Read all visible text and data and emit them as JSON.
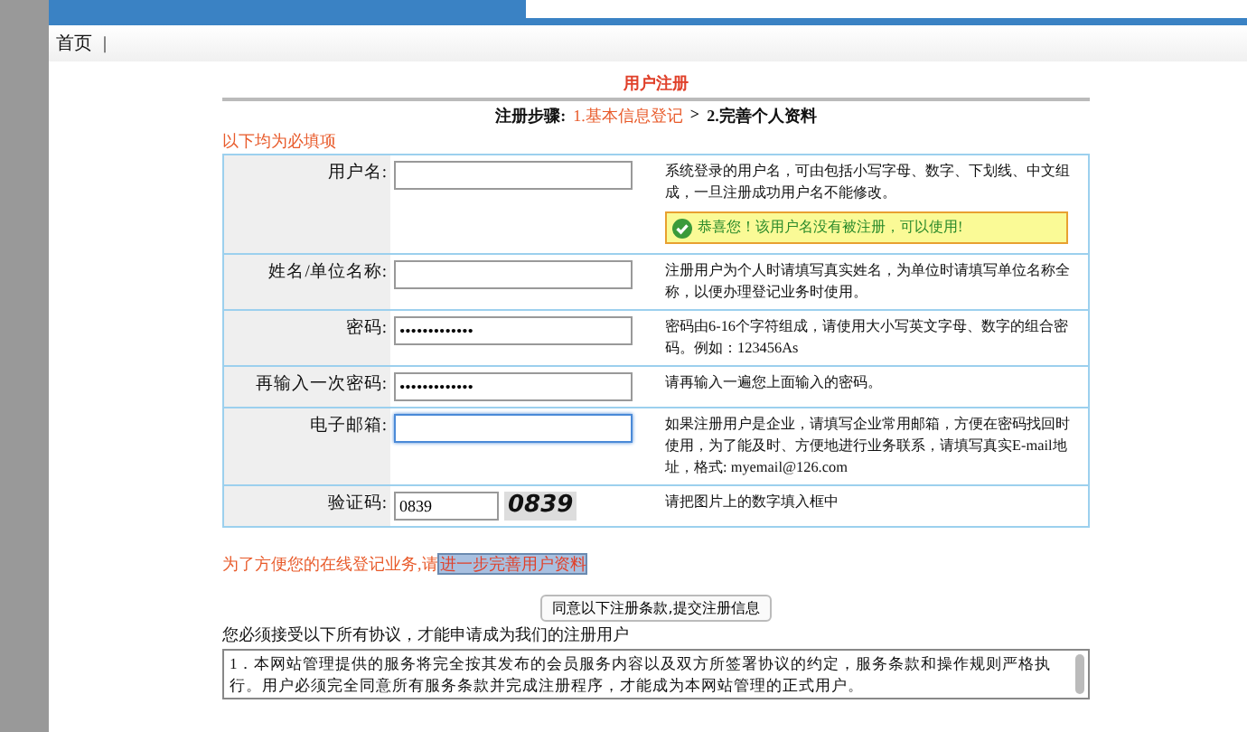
{
  "nav": {
    "items": [
      "首页",
      "|"
    ]
  },
  "title": "用户注册",
  "steps": {
    "label": "注册步骤:",
    "items": [
      {
        "text": "1.基本信息登记",
        "selected": true
      },
      {
        "text": "2.完善个人资料",
        "selected": false
      }
    ],
    "separator": ">"
  },
  "required_note": "以下均为必填项",
  "rows": [
    {
      "kind": "text",
      "label": "用户名:",
      "value": "",
      "hint": "系统登录的用户名，可由包括小写字母、数字、下划线、中文组成，一旦注册成功用户名不能修改。",
      "success": "恭喜您！该用户名没有被注册，可以使用!"
    },
    {
      "kind": "text",
      "label": "姓名/单位名称:",
      "value": "",
      "hint": "注册用户为个人时请填写真实姓名，为单位时请填写单位名称全称，以便办理登记业务时使用。"
    },
    {
      "kind": "password",
      "label": "密码:",
      "value": "•••••••••••••",
      "hint": "密码由6-16个字符组成，请使用大小写英文字母、数字的组合密码。例如：123456As"
    },
    {
      "kind": "password",
      "label": "再输入一次密码:",
      "value": "•••••••••••••",
      "hint": "请再输入一遍您上面输入的密码。"
    },
    {
      "kind": "text",
      "label": "电子邮箱:",
      "value": "",
      "focused": true,
      "hint": "如果注册用户是企业，请填写企业常用邮箱，方便在密码找回时使用，为了能及时、方便地进行业务联系，请填写真实E-mail地址，格式: myemail@126.com"
    },
    {
      "kind": "captcha",
      "label": "验证码:",
      "value": "0839",
      "captcha": "0839",
      "hint": "请把图片上的数字填入框中"
    }
  ],
  "promo": {
    "text": "为了方便您的在线登记业务,请",
    "link": "进一步完善用户资料"
  },
  "submit_button": "同意以下注册条款,提交注册信息",
  "agreement_note": "您必须接受以下所有协议，才能申请成为我们的注册用户",
  "agreement_text": "1．本网站管理提供的服务将完全按其发布的会员服务内容以及双方所签署协议的约定，服务条款和操作规则严格执行。用户必须完全同意所有服务条款并完成注册程序，才能成为本网站管理的正式用户。"
}
